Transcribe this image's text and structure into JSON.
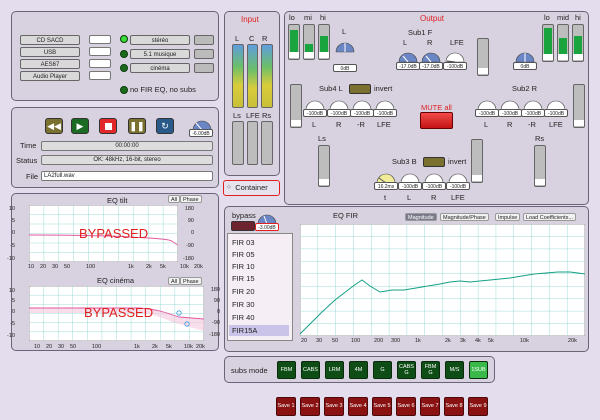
{
  "source": {
    "inputs": [
      "CD SACD",
      "USB",
      "AES67",
      "Audio Player"
    ],
    "modes": [
      "stéréo",
      "5.1 musique",
      "cinéma"
    ],
    "no_fir_label": "no FIR EQ, no subs"
  },
  "player": {
    "volume": "-6.00dB",
    "time_label": "Time",
    "time_value": "00:00:00",
    "status_label": "Status",
    "status_value": "OK: 48kHz, 16-bit, stereo",
    "file_label": "File",
    "file_value": "LA2full.wav"
  },
  "input": {
    "title": "Input",
    "channels": [
      "L",
      "C",
      "R"
    ],
    "lfe_labels": [
      "Ls",
      "LFE",
      "Rs"
    ],
    "container_button": "Container"
  },
  "output": {
    "title": "Output",
    "left_meter_labels": [
      "lo",
      "mi",
      "hi"
    ],
    "right_meter_labels": [
      "lo",
      "mid",
      "hi"
    ],
    "sub1f_title": "Sub1 F",
    "sub1f_knob_labels": [
      "L",
      "R",
      "LFE"
    ],
    "sub1f_values": [
      "-17.0dB",
      "-17.0dB",
      "-100dB"
    ],
    "left_L_label": "L",
    "left_L_value": "0dB",
    "right_value": "0dB",
    "sub4l_title": "Sub4 L",
    "invert": "invert",
    "sub4l_labels": [
      "L",
      "R",
      "-R",
      "LFE"
    ],
    "sub4l_values": [
      "-100dB",
      "-100dB",
      "-100dB",
      "-100dB"
    ],
    "sub2r_title": "Sub2 R",
    "sub2r_labels": [
      "L",
      "R",
      "-R",
      "LFE"
    ],
    "sub2r_values": [
      "-100dB",
      "-100dB",
      "-100dB",
      "-100dB"
    ],
    "mute_all": "MUTE all",
    "ls": "Ls",
    "rs": "Rs",
    "sub3b_title": "Sub3 B",
    "sub3b_labels": [
      "t",
      "L",
      "R",
      "LFE"
    ],
    "sub3b_values": [
      "16.2ms",
      "-100dB",
      "-100dB",
      "-100dB"
    ],
    "small_meter_value": "-100dB"
  },
  "eq_tilt": {
    "title": "EQ tilt",
    "buttons": [
      "All",
      "Phase"
    ],
    "bypassed": "BYPASSED",
    "y_left": [
      "10",
      "5",
      "0",
      "-5",
      "-10"
    ],
    "y_right": [
      "180",
      "90",
      "0",
      "-90",
      "-180"
    ],
    "x_ticks": [
      "10",
      "20",
      "30",
      "50",
      "100",
      "1k",
      "2k",
      "5k",
      "10k",
      "20k"
    ]
  },
  "eq_cinema": {
    "title": "EQ cinéma",
    "buttons": [
      "All",
      "Phase"
    ],
    "bypassed": "BYPASSED",
    "y_left": [
      "10",
      "5",
      "0",
      "-5",
      "-10"
    ],
    "y_right": [
      "180",
      "90",
      "0",
      "-90",
      "-180"
    ],
    "x_ticks": [
      "10",
      "20",
      "30",
      "50",
      "100",
      "1k",
      "2k",
      "5k",
      "10k",
      "20k"
    ]
  },
  "fir": {
    "bypass_label": "bypass",
    "knob_value": "-3.00dB",
    "list": [
      "FIR 03",
      "FIR 05",
      "FIR 10",
      "FIR 15",
      "FIR 20",
      "FIR 30",
      "FIR 40",
      "FIR15A"
    ],
    "selected": "FIR15A",
    "title": "EQ FIR",
    "tabs": [
      "Magnitude",
      "Magnitude/Phase",
      "Impulse",
      "Load Coefficients..."
    ],
    "x_ticks": [
      "20",
      "30",
      "50",
      "100",
      "200",
      "300",
      "1k",
      "2k",
      "3k",
      "4k",
      "5k",
      "10k",
      "20k"
    ]
  },
  "subs_mode": {
    "label": "subs mode",
    "buttons": [
      "FBM",
      "CABS",
      "LRM",
      "4M",
      "G",
      "CABS G",
      "FBM G",
      "M/S",
      "1SUB"
    ],
    "active": "1SUB"
  },
  "saves": [
    "Save 1",
    "Save 2",
    "Save 3",
    "Save 4",
    "Save 5",
    "Save 6",
    "Save 7",
    "Save 8",
    "Save 9"
  ],
  "colors": {
    "accent_red": "#e02020",
    "meter_green": "#19a43d",
    "button_dark_green": "#0f4d16",
    "button_active_green": "#3bb84a",
    "save_red": "#8a1212",
    "chart_line": "#16a085"
  }
}
